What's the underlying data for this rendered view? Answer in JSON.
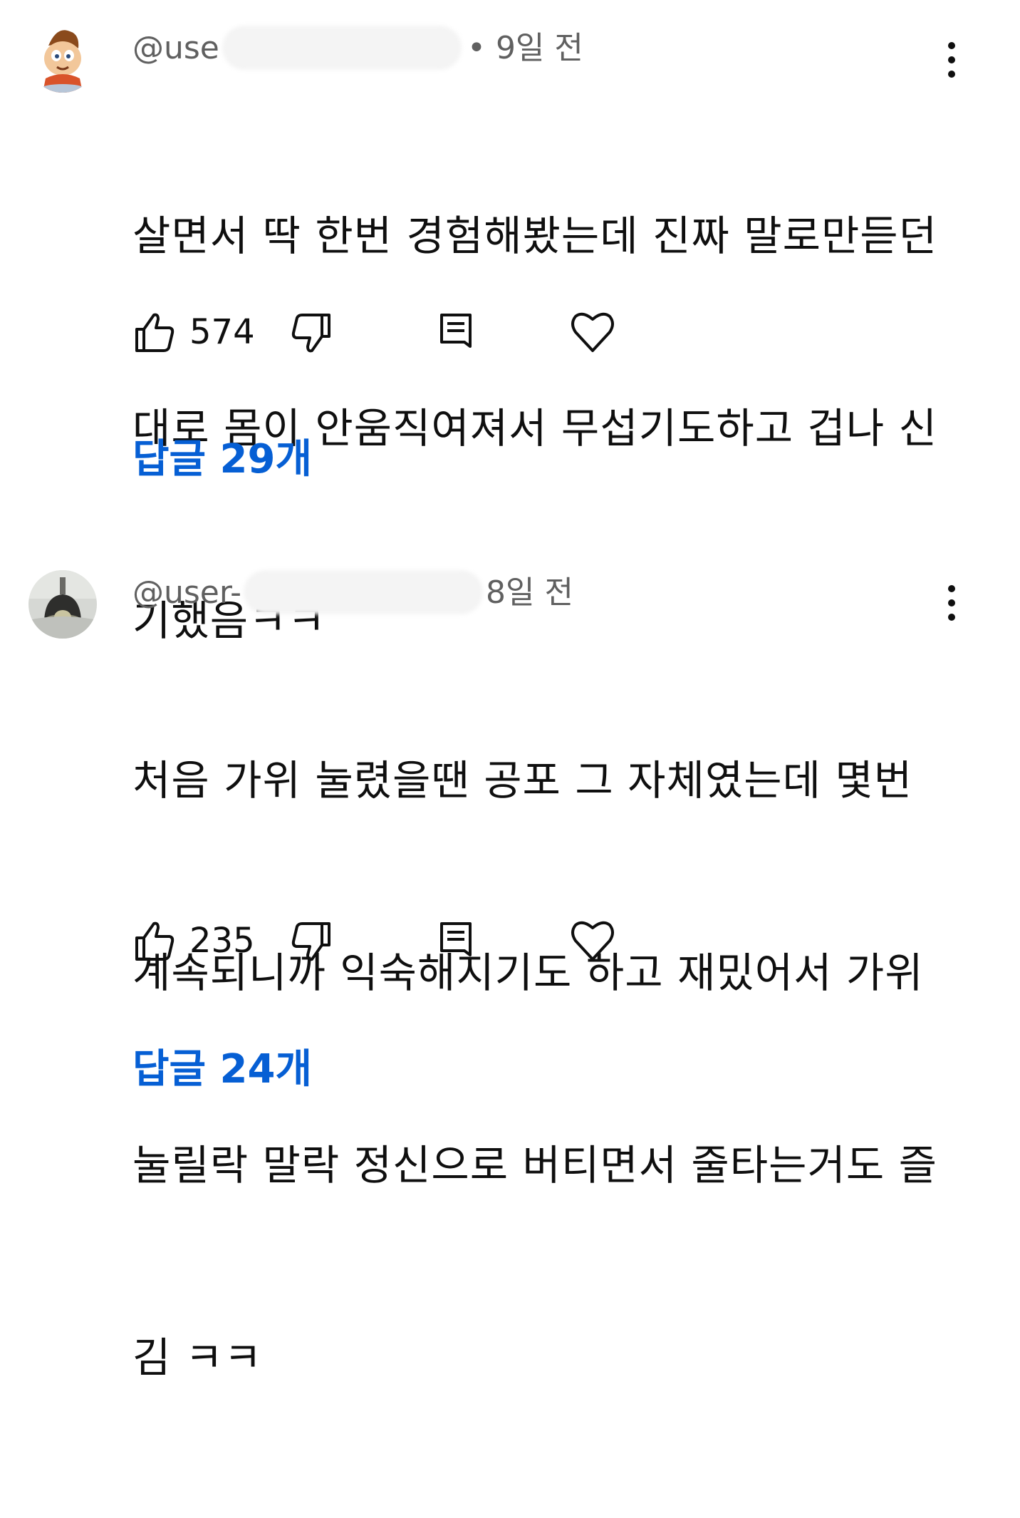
{
  "comments": [
    {
      "handle": "@use",
      "time": "• 9일 전",
      "lines": [
        "살면서 딱 한번 경험해봤는데 진짜 말로만듣던",
        "대로 몸이 안움직여져서 무섭기도하고 겁나 신",
        "기했음ㅋㅋ"
      ],
      "likes": "574",
      "replies": "답글 29개",
      "avatar_icon": "cartoon-boy-avatar-icon"
    },
    {
      "handle": "@user-",
      "time": "8일 전",
      "lines": [
        "처음 가위 눌렸을땐 공포 그 자체였는데 몇번",
        "계속되니까 익숙해지기도 하고 재밌어서 가위",
        "눌릴락 말락 정신으로 버티면서 줄타는거도 즐",
        "김 ㅋㅋ"
      ],
      "likes": "235",
      "replies": "답글 24개",
      "avatar_icon": "lamp-photo-avatar-icon"
    }
  ],
  "colors": {
    "link": "#065fd4",
    "meta": "#606060",
    "text": "#0f0f0f"
  },
  "icons": [
    "thumbs-up-icon",
    "thumbs-down-icon",
    "reply-icon",
    "heart-icon",
    "more-vert-icon"
  ]
}
